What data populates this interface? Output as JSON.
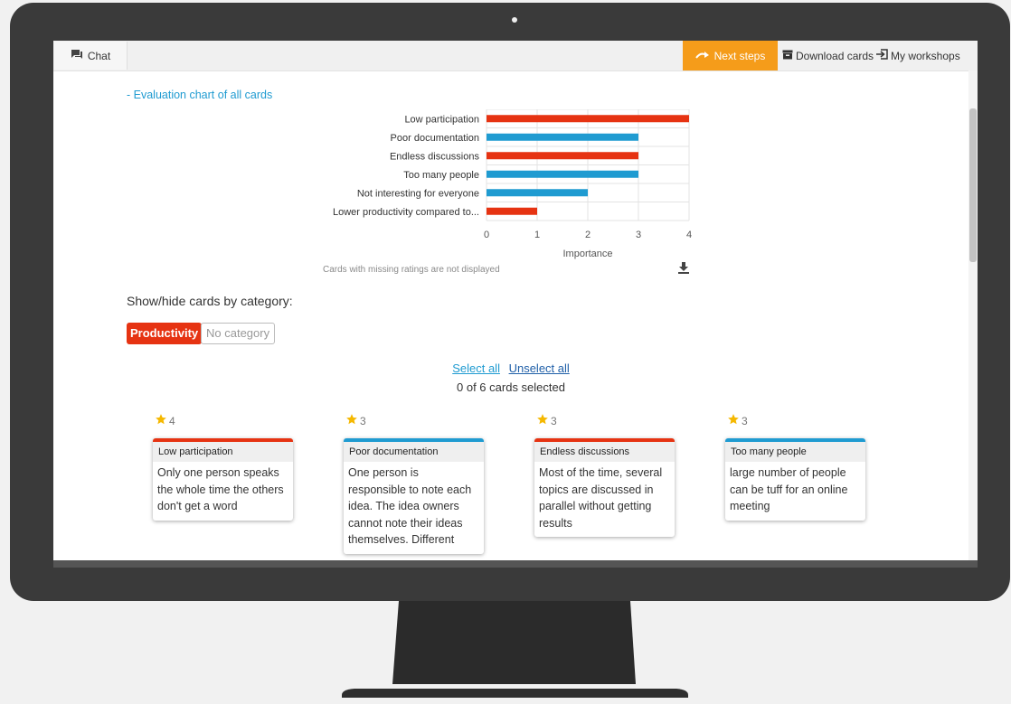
{
  "topbar": {
    "chat_label": "Chat",
    "next_steps_label": "Next steps",
    "download_label": "Download cards",
    "workshops_label": "My workshops"
  },
  "evaluation": {
    "title": "- Evaluation chart of all cards",
    "missing_note": "Cards with missing ratings are not displayed"
  },
  "chart_data": {
    "type": "bar",
    "orientation": "horizontal",
    "categories": [
      "Low participation",
      "Poor documentation",
      "Endless discussions",
      "Too many people",
      "Not interesting for everyone",
      "Lower productivity compared to..."
    ],
    "values": [
      4,
      3,
      3,
      3,
      2,
      1
    ],
    "bar_colors": [
      "#e63312",
      "#1f9bd1",
      "#e63312",
      "#1f9bd1",
      "#1f9bd1",
      "#e63312"
    ],
    "xlabel": "Importance",
    "xlim": [
      0,
      4
    ],
    "xticks": [
      "0",
      "1",
      "2",
      "3",
      "4"
    ],
    "grid": true
  },
  "filter": {
    "label": "Show/hide cards by category:",
    "categories": [
      {
        "label": "Productivity",
        "active": true,
        "color": "#e63312"
      },
      {
        "label": "No category",
        "active": false
      }
    ]
  },
  "selection": {
    "select_all": "Select all",
    "unselect_all": "Unselect all",
    "count_text": "0 of 6 cards selected"
  },
  "cards": [
    {
      "rating": "4",
      "title": "Low participation",
      "text": "Only one person speaks the whole time the others don't get a word",
      "color": "#e63312"
    },
    {
      "rating": "3",
      "title": "Poor documentation",
      "text": "One person is responsible to note each idea. The idea owners cannot note their ideas themselves. Different",
      "color": "#1f9bd1"
    },
    {
      "rating": "3",
      "title": "Endless discussions",
      "text": "Most of the time, several topics are discussed in parallel without getting results",
      "color": "#e63312"
    },
    {
      "rating": "3",
      "title": "Too many people",
      "text": "large number of people can be tuff for an online meeting",
      "color": "#1f9bd1"
    }
  ],
  "colors": {
    "accent_orange": "#f59c1a",
    "link_blue": "#1f9bd1",
    "category_red": "#e63312",
    "star_gold": "#f5b800"
  }
}
